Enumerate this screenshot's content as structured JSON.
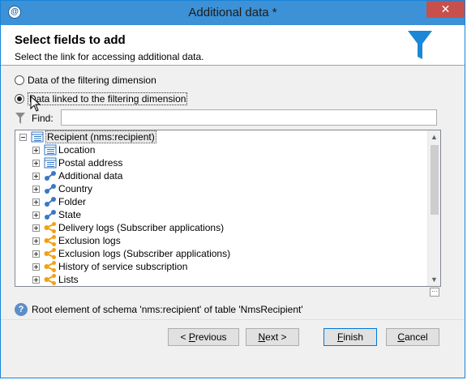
{
  "window": {
    "title": "Additional data *",
    "close_glyph": "✕",
    "app_icon_glyph": "@"
  },
  "header": {
    "title": "Select fields to add",
    "subtitle": "Select the link for accessing additional data."
  },
  "options": [
    {
      "label": "Data of the filtering dimension",
      "checked": false
    },
    {
      "label": "Data linked to the filtering dimension",
      "checked": true
    }
  ],
  "find": {
    "label": "Find:",
    "value": ""
  },
  "tree": {
    "root": {
      "label": "Recipient (nms:recipient)",
      "icon": "table-icon"
    },
    "items": [
      {
        "label": "Location",
        "icon": "table-icon"
      },
      {
        "label": "Postal address",
        "icon": "table-icon"
      },
      {
        "label": "Additional data",
        "icon": "link-icon"
      },
      {
        "label": "Country",
        "icon": "link-icon"
      },
      {
        "label": "Folder",
        "icon": "link-icon"
      },
      {
        "label": "State",
        "icon": "link-icon"
      },
      {
        "label": "Delivery logs (Subscriber applications)",
        "icon": "collection-link-icon"
      },
      {
        "label": "Exclusion logs",
        "icon": "collection-link-icon"
      },
      {
        "label": "Exclusion logs (Subscriber applications)",
        "icon": "collection-link-icon"
      },
      {
        "label": "History of service subscription",
        "icon": "collection-link-icon"
      },
      {
        "label": "Lists",
        "icon": "collection-link-icon"
      }
    ]
  },
  "info": {
    "text": "Root element of schema 'nms:recipient' of table 'NmsRecipient'"
  },
  "buttons": {
    "previous": {
      "prefix": "< ",
      "mnemonic": "P",
      "rest": "revious"
    },
    "next": {
      "mnemonic": "N",
      "rest": "ext >"
    },
    "finish": {
      "mnemonic": "F",
      "rest": "inish"
    },
    "cancel": {
      "mnemonic": "C",
      "rest": "ancel"
    }
  },
  "colors": {
    "titlebar": "#3d91d6",
    "accent": "#1b87d6",
    "close": "#c7504c"
  }
}
